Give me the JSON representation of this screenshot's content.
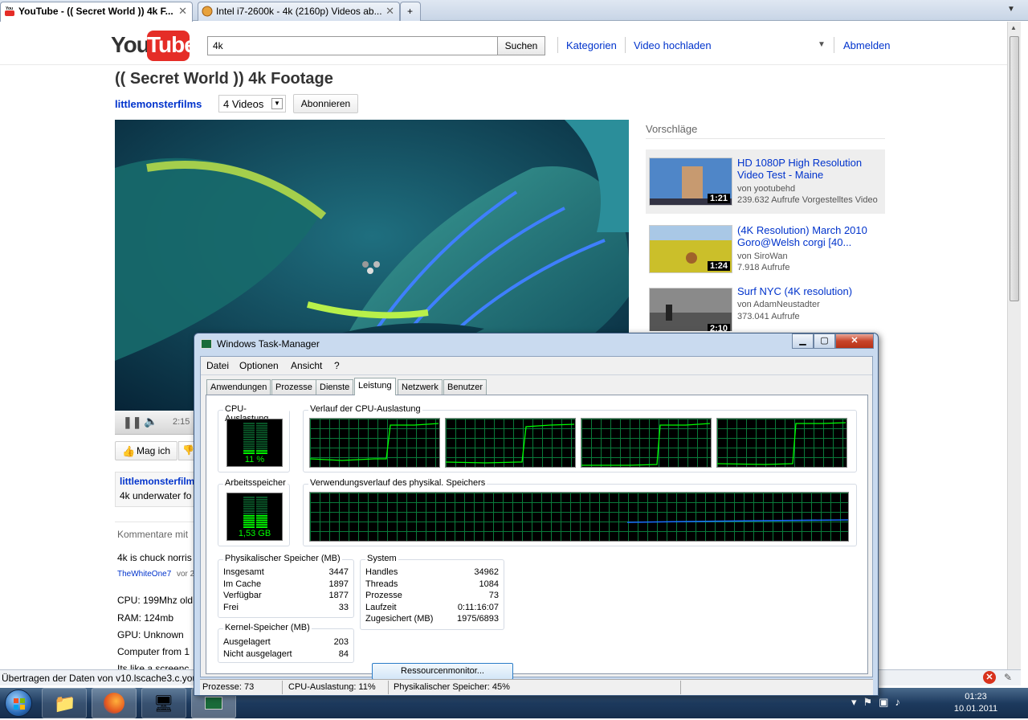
{
  "browser": {
    "tabs": [
      {
        "label": "YouTube - (( Secret World )) 4k F...",
        "active": true
      },
      {
        "label": "Intel i7-2600k - 4k (2160p) Videos ab...",
        "active": false
      }
    ],
    "new_tab_symbol": "+",
    "status_text": "Übertragen der Daten von v10.lscache3.c.youtu"
  },
  "youtube": {
    "logo_text_you": "You",
    "logo_text_tube": "Tube",
    "search_value": "4k",
    "search_button": "Suchen",
    "nav": {
      "categories": "Kategorien",
      "upload": "Video hochladen",
      "logout": "Abmelden"
    },
    "video_title": "(( Secret World )) 4k Footage",
    "channel": "littlemonsterfilms",
    "videos_count": "4 Videos",
    "subscribe": "Abonnieren",
    "player_time": "2:15",
    "like": "Mag ich",
    "desc_user": "littlemonsterfilm",
    "desc_text": "4k underwater fo",
    "comments_header": "Kommentare mit",
    "comments": [
      {
        "text": "4k is chuck norris",
        "user": "TheWhiteOne7",
        "meta": "vor 2"
      },
      {
        "text": "CPU: 199Mhz old"
      },
      {
        "text": "RAM: 124mb"
      },
      {
        "text": "GPU: Unknown"
      },
      {
        "text": "Computer from 1"
      },
      {
        "text": "Its like a screenc"
      }
    ],
    "suggestions_title": "Vorschläge",
    "suggestions": [
      {
        "title": "HD 1080P High Resolution Video Test - Maine",
        "by": "von yootubehd",
        "meta": "239.632 Aufrufe Vorgestelltes Video",
        "duration": "1:21"
      },
      {
        "title": "(4K Resolution) March 2010 Goro@Welsh corgi [40...",
        "by": "von SiroWan",
        "meta": "7.918 Aufrufe",
        "duration": "1:24"
      },
      {
        "title": "Surf NYC (4K resolution)",
        "by": "von AdamNeustadter",
        "meta": "373.041 Aufrufe",
        "duration": "2:10"
      }
    ]
  },
  "task_manager": {
    "title": "Windows Task-Manager",
    "menu": [
      "Datei",
      "Optionen",
      "Ansicht",
      "?"
    ],
    "tabs": [
      "Anwendungen",
      "Prozesse",
      "Dienste",
      "Leistung",
      "Netzwerk",
      "Benutzer"
    ],
    "active_tab": "Leistung",
    "cpu_usage_label": "CPU-Auslastung",
    "cpu_usage_value": "11 %",
    "cpu_usage_fraction": 0.11,
    "cpu_history_label": "Verlauf der CPU-Auslastung",
    "mem_label": "Arbeitsspeicher",
    "mem_value": "1,53 GB",
    "mem_fraction": 0.45,
    "mem_history_label": "Verwendungsverlauf des physikal. Speichers",
    "physical": {
      "title": "Physikalischer Speicher (MB)",
      "rows": [
        {
          "label": "Insgesamt",
          "value": "3447"
        },
        {
          "label": "Im Cache",
          "value": "1897"
        },
        {
          "label": "Verfügbar",
          "value": "1877"
        },
        {
          "label": "Frei",
          "value": "33"
        }
      ]
    },
    "kernel": {
      "title": "Kernel-Speicher (MB)",
      "rows": [
        {
          "label": "Ausgelagert",
          "value": "203"
        },
        {
          "label": "Nicht ausgelagert",
          "value": "84"
        }
      ]
    },
    "system": {
      "title": "System",
      "rows": [
        {
          "label": "Handles",
          "value": "34962"
        },
        {
          "label": "Threads",
          "value": "1084"
        },
        {
          "label": "Prozesse",
          "value": "73"
        },
        {
          "label": "Laufzeit",
          "value": "0:11:16:07"
        },
        {
          "label": "Zugesichert (MB)",
          "value": "1975/6893"
        }
      ]
    },
    "resource_monitor": "Ressourcenmonitor...",
    "status": {
      "processes": "Prozesse: 73",
      "cpu": "CPU-Auslastung: 11%",
      "memory": "Physikalischer Speicher: 45%"
    }
  },
  "taskbar": {
    "time": "01:23",
    "date": "10.01.2011"
  },
  "colors": {
    "youtube_red": "#e52d27",
    "link_blue": "#0033cc",
    "graph_green": "#00ff00",
    "graph_grid": "#0a7a3a",
    "mem_line": "#1a6fff"
  }
}
